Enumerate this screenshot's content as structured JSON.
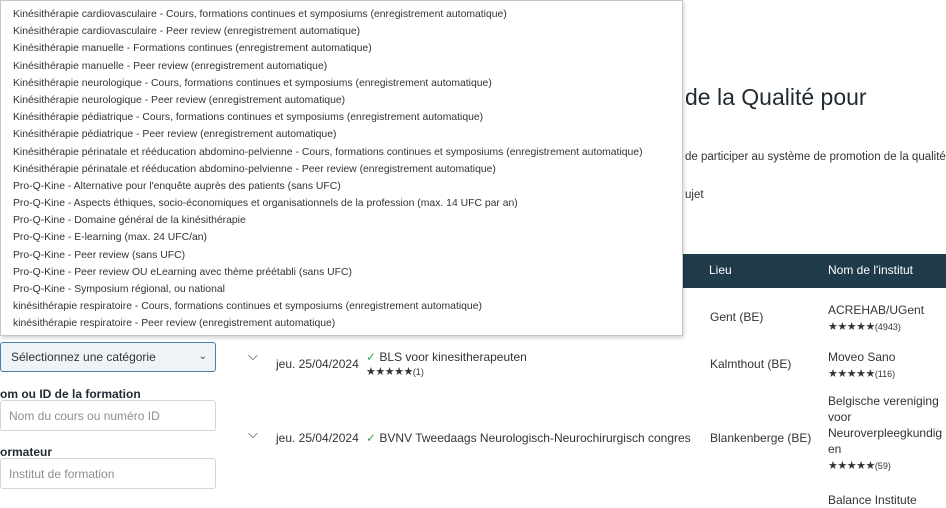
{
  "page": {
    "heading": "de la Qualité pour",
    "intro_text": "de participer au système de promotion de la qualité",
    "sujet_text": "ujet"
  },
  "table": {
    "columns": [
      "Lieu",
      "Nom de l'institut"
    ],
    "partial_institute": "ACREHAB/UGent",
    "partial_location": "Gent (BE)",
    "partial_rating": "★★★★★",
    "partial_count": "(4943)",
    "rows": [
      {
        "date": "jeu. 25/04/2024",
        "title": "BLS voor kinesitherapeuten",
        "title_rating": "★★★★★",
        "title_count": "(1)",
        "location": "Kalmthout (BE)",
        "institute_lines": [
          "Moveo Sano"
        ],
        "institute_rating": "★★★★★",
        "institute_count": "(116)"
      },
      {
        "date": "jeu. 25/04/2024",
        "title": "BVNV Tweedaags Neurologisch-Neurochirurgisch congres",
        "location": "Blankenberge (BE)",
        "institute_lines": [
          "Belgische vereniging",
          "voor",
          "Neuroverpleegkundig",
          "en"
        ],
        "institute_rating": "★★★★★",
        "institute_count": "(59)"
      }
    ],
    "next_row_institute": "Balance Institute"
  },
  "filters": {
    "category_select_value": "Sélectionnez une catégorie",
    "course_label": "om ou ID de la formation",
    "course_placeholder": "Nom du cours ou numéro ID",
    "trainer_label": "ormateur",
    "trainer_placeholder": "Institut de formation"
  },
  "dropdown_options": [
    "Kinésithérapie cardiovasculaire - Cours, formations continues et symposiums (enregistrement automatique)",
    "Kinésithérapie cardiovasculaire - Peer review (enregistrement automatique)",
    "Kinésithérapie manuelle - Formations continues (enregistrement automatique)",
    "Kinésithérapie manuelle - Peer review (enregistrement automatique)",
    "Kinésithérapie neurologique - Cours, formations continues et symposiums (enregistrement automatique)",
    "Kinésithérapie neurologique - Peer review (enregistrement automatique)",
    "Kinésithérapie pédiatrique - Cours, formations continues et symposiums (enregistrement automatique)",
    "Kinésithérapie pédiatrique - Peer review (enregistrement automatique)",
    "Kinésithérapie périnatale et rééducation abdomino-pelvienne - Cours, formations continues et symposiums (enregistrement automatique)",
    "Kinésithérapie périnatale et rééducation abdomino-pelvienne - Peer review (enregistrement automatique)",
    "Pro-Q-Kine - Alternative pour l'enquête auprès des patients (sans UFC)",
    "Pro-Q-Kine - Aspects éthiques, socio-économiques et organisationnels de la profession (max. 14 UFC par an)",
    "Pro-Q-Kine - Domaine général de la kinésithérapie",
    "Pro-Q-Kine - E-learning (max. 24 UFC/an)",
    "Pro-Q-Kine - Peer review (sans UFC)",
    "Pro-Q-Kine - Peer review OU eLearning avec thème préétabli (sans UFC)",
    "Pro-Q-Kine - Symposium régional, ou national",
    "kinésithérapie respiratoire - Cours, formations continues et symposiums (enregistrement automatique)",
    "kinésithérapie respiratoire - Peer review (enregistrement automatique)"
  ],
  "icons": {
    "chevron": "chevron-down-icon",
    "check": "check-icon",
    "star": "star-icon"
  },
  "colors": {
    "table_header": "#1f3b4a",
    "check_green": "#3aa757",
    "select_border": "#4d7ea8"
  }
}
